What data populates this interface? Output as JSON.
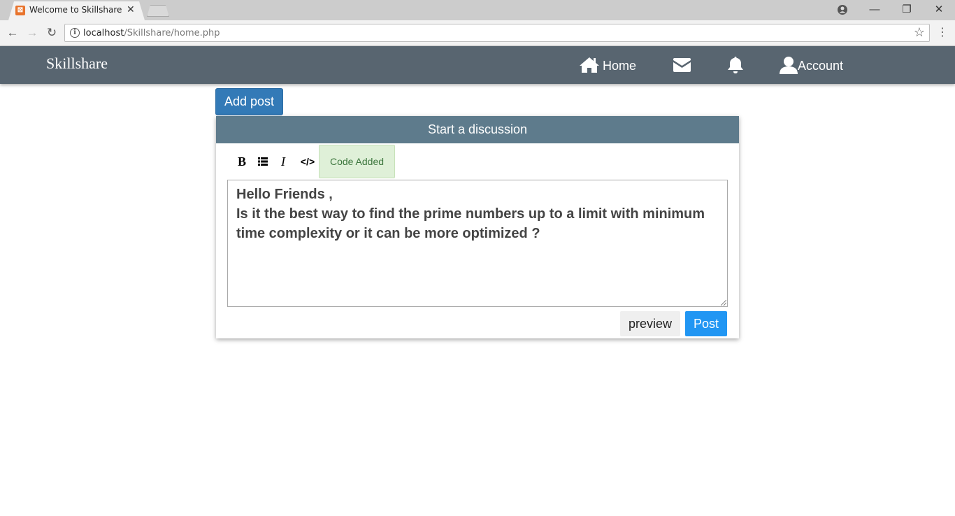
{
  "browser": {
    "tab_title": "Welcome to Skillshare | B",
    "url_host": "localhost",
    "url_path": "/Skillshare/home.php"
  },
  "navbar": {
    "brand": "Skillshare",
    "home_label": "Home",
    "account_label": "Account"
  },
  "actions": {
    "add_post_label": "Add post"
  },
  "discussion": {
    "header": "Start a discussion",
    "format_buttons": {
      "bold": "B",
      "italic": "I",
      "code": "</>"
    },
    "code_status": "Code Added",
    "editor_lines": [
      "Hello Friends ,",
      "Is it the best way to find the prime numbers up to a limit with minimum time complexity or it can be more optimized ?"
    ],
    "preview_label": "preview",
    "post_label": "Post"
  }
}
